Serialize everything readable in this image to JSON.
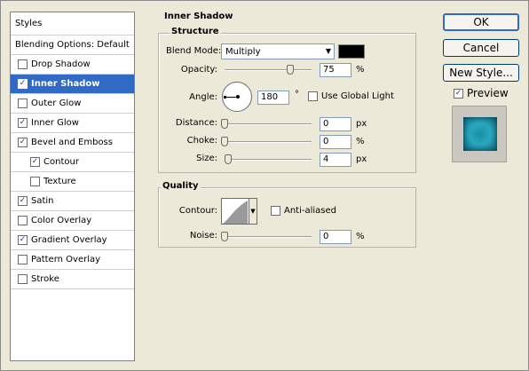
{
  "styles_panel": {
    "header": "Styles",
    "items": [
      {
        "label": "Blending Options: Default",
        "checkbox": false,
        "checked": false,
        "selected": false,
        "indent": false
      },
      {
        "label": "Drop Shadow",
        "checkbox": true,
        "checked": false,
        "selected": false,
        "indent": false
      },
      {
        "label": "Inner Shadow",
        "checkbox": true,
        "checked": true,
        "selected": true,
        "indent": false
      },
      {
        "label": "Outer Glow",
        "checkbox": true,
        "checked": false,
        "selected": false,
        "indent": false
      },
      {
        "label": "Inner Glow",
        "checkbox": true,
        "checked": true,
        "selected": false,
        "indent": false
      },
      {
        "label": "Bevel and Emboss",
        "checkbox": true,
        "checked": true,
        "selected": false,
        "indent": false
      },
      {
        "label": "Contour",
        "checkbox": true,
        "checked": true,
        "selected": false,
        "indent": true
      },
      {
        "label": "Texture",
        "checkbox": true,
        "checked": false,
        "selected": false,
        "indent": true
      },
      {
        "label": "Satin",
        "checkbox": true,
        "checked": true,
        "selected": false,
        "indent": false
      },
      {
        "label": "Color Overlay",
        "checkbox": true,
        "checked": false,
        "selected": false,
        "indent": false
      },
      {
        "label": "Gradient Overlay",
        "checkbox": true,
        "checked": true,
        "selected": false,
        "indent": false
      },
      {
        "label": "Pattern Overlay",
        "checkbox": true,
        "checked": false,
        "selected": false,
        "indent": false
      },
      {
        "label": "Stroke",
        "checkbox": true,
        "checked": false,
        "selected": false,
        "indent": false
      }
    ]
  },
  "inner_shadow": {
    "title": "Inner Shadow",
    "structure": {
      "title": "Structure",
      "blend_mode_label": "Blend Mode:",
      "blend_mode_value": "Multiply",
      "swatch_color": "#000000",
      "opacity_label": "Opacity:",
      "opacity_value": "75",
      "opacity_unit": "%",
      "opacity_level": 0.75,
      "angle_label": "Angle:",
      "angle_value": "180",
      "angle_unit": "°",
      "use_global_light_label": "Use Global Light",
      "use_global_light_checked": false,
      "distance_label": "Distance:",
      "distance_value": "0",
      "distance_unit": "px",
      "choke_label": "Choke:",
      "choke_value": "0",
      "choke_unit": "%",
      "size_label": "Size:",
      "size_value": "4",
      "size_unit": "px"
    },
    "quality": {
      "title": "Quality",
      "contour_label": "Contour:",
      "anti_aliased_label": "Anti-aliased",
      "anti_aliased_checked": false,
      "noise_label": "Noise:",
      "noise_value": "0",
      "noise_unit": "%"
    }
  },
  "buttons": {
    "ok": "OK",
    "cancel": "Cancel",
    "new_style": "New Style...",
    "preview_label": "Preview",
    "preview_checked": true
  },
  "colors": {
    "selection": "#316ac5",
    "preview_fill": "#1a8fa3"
  }
}
